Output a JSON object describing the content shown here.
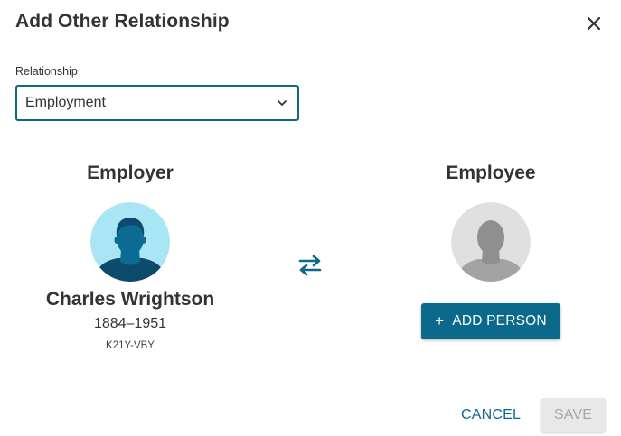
{
  "dialog": {
    "title": "Add Other Relationship"
  },
  "relationship": {
    "label": "Relationship",
    "value": "Employment"
  },
  "employer": {
    "heading": "Employer",
    "name": "Charles Wrightson",
    "dates": "1884–1951",
    "id": "K21Y-VBY"
  },
  "employee": {
    "heading": "Employee",
    "add_person_label": "ADD PERSON"
  },
  "footer": {
    "cancel_label": "CANCEL",
    "save_label": "SAVE"
  },
  "colors": {
    "accent": "#0b6a8c",
    "select_border": "#0b6a7f",
    "disabled_bg": "#e8e8e8",
    "disabled_text": "#a6a6a6"
  },
  "icons": {
    "close": "close-icon",
    "dropdown": "chevron-down-icon",
    "swap": "swap-arrows-icon",
    "add": "plus-icon",
    "male_avatar": "male-avatar-icon",
    "unknown_avatar": "unknown-person-avatar-icon"
  }
}
